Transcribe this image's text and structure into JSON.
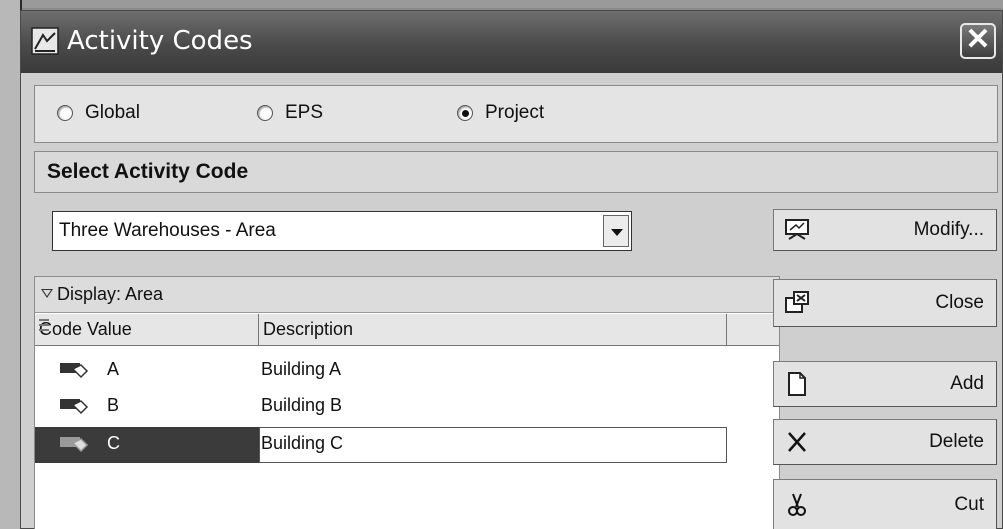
{
  "window": {
    "title": "Activity Codes",
    "close_glyph": "✕"
  },
  "scope": {
    "options": [
      {
        "label": "Global",
        "selected": false
      },
      {
        "label": "EPS",
        "selected": false
      },
      {
        "label": "Project",
        "selected": true
      }
    ]
  },
  "select_section": {
    "header": "Select Activity Code",
    "current_value": "Three Warehouses - Area"
  },
  "buttons": {
    "modify": "Modify...",
    "close": "Close",
    "add": "Add",
    "delete": "Delete",
    "cut": "Cut"
  },
  "list": {
    "display_label": "Display: Area",
    "columns": [
      "Code Value",
      "Description"
    ],
    "rows": [
      {
        "code": "A",
        "description": "Building A",
        "selected": false
      },
      {
        "code": "B",
        "description": "Building B",
        "selected": false
      },
      {
        "code": "C",
        "description": "Building C",
        "selected": true
      }
    ]
  },
  "icons": {
    "title": "activity-codes-icon",
    "modify": "modify-icon",
    "close": "close-dialog-icon",
    "add": "new-document-icon",
    "delete": "delete-x-icon",
    "cut": "scissors-icon",
    "row": "code-tag-icon"
  }
}
